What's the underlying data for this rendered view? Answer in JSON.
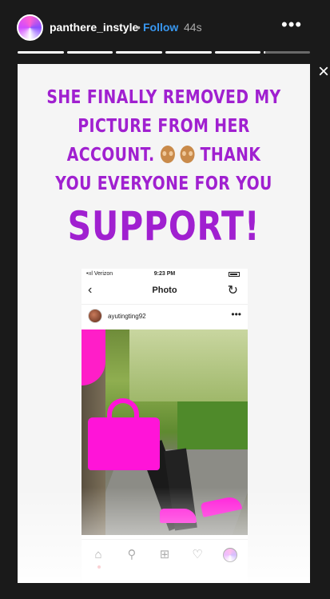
{
  "header": {
    "username": "panthere_instyle",
    "separator": "•",
    "follow_label": "Follow",
    "timestamp": "44s",
    "more_label": "•••",
    "close_label": "×"
  },
  "progress": {
    "segment_count": 6,
    "segments_filled": [
      1,
      1,
      1,
      1,
      1,
      0.03
    ]
  },
  "story": {
    "lines": [
      "SHE FINALLY REMOVED MY",
      "PICTURE FROM HER",
      "ACCOUNT.",
      "THANK",
      "YOU EVERYONE FOR YOU",
      "SUPPORT!"
    ],
    "text_color": "#a020d0"
  },
  "phone": {
    "carrier": "•ııl Verizon",
    "time": "9:23 PM",
    "title": "Photo",
    "back_icon": "‹",
    "refresh_icon": "↻",
    "post_user": "ayutingting92",
    "post_more": "•••",
    "tabs": {
      "home": "⌂",
      "search": "⚲",
      "add": "⊞",
      "heart": "♡"
    }
  },
  "colors": {
    "accent": "#3897f0",
    "story_bg": "#f5f5f5",
    "pink": "#ff14d8"
  }
}
